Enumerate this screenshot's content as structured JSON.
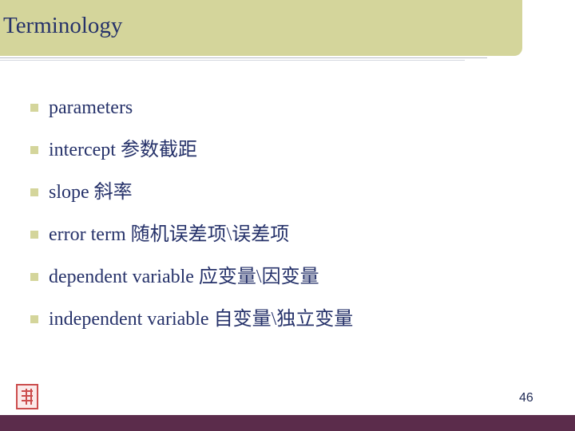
{
  "slide": {
    "title": "Terminology",
    "page_number": "46",
    "accent_color": "#d4d59b",
    "text_color": "#26326a",
    "footer_color": "#5b2c4b",
    "logo_icon": "red-seal-logo-icon"
  },
  "bullets": [
    {
      "text": "parameters"
    },
    {
      "text": "intercept 参数截距"
    },
    {
      "text": "slope 斜率"
    },
    {
      "text": " error term 随机误差项\\误差项"
    },
    {
      "text": "dependent variable 应变量\\因变量"
    },
    {
      "text": " independent variable 自变量\\独立变量"
    }
  ]
}
